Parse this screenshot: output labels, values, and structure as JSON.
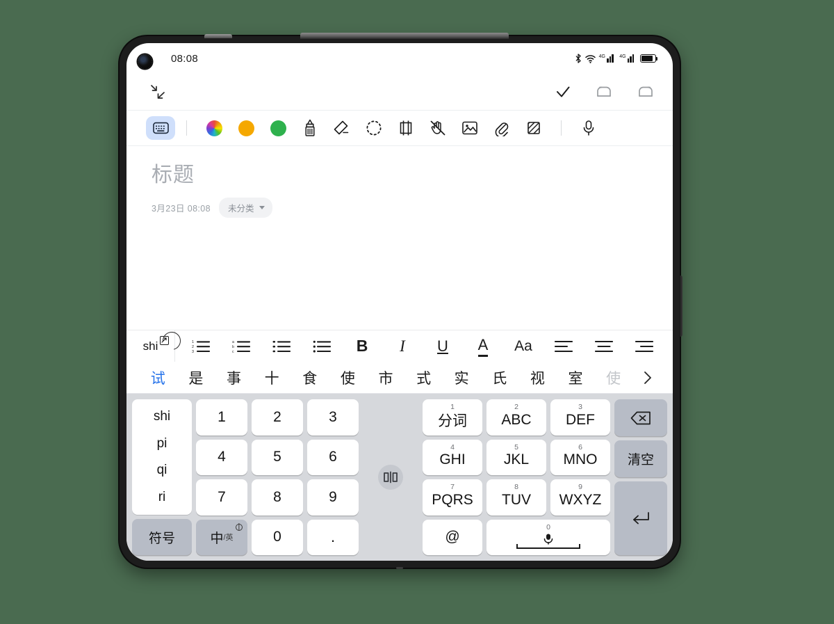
{
  "theme": {
    "background": "#4a6b50",
    "frame": "#1d1d1d",
    "accent": "#2673ea",
    "keyboard_bg": "#d6d8dc",
    "key_bg": "#ffffff",
    "key_gray": "#b7bcc6",
    "chip_bg": "#cfdffb"
  },
  "status_bar": {
    "time": "08:08",
    "icons": [
      "bluetooth-icon",
      "wifi-icon",
      "signal-icon",
      "signal-icon",
      "battery-icon"
    ],
    "signal_label": "4G"
  },
  "app_bar": {
    "collapse_icon": "collapse-arrows-icon",
    "actions": [
      {
        "name": "confirm-check-icon",
        "label": "✓"
      },
      {
        "name": "undo-icon",
        "label": "undo"
      },
      {
        "name": "redo-icon",
        "label": "redo"
      }
    ]
  },
  "toolbar": {
    "keyboard_toggle": "keyboard-icon",
    "items": [
      {
        "name": "color-wheel-icon",
        "type": "wheel",
        "color": ""
      },
      {
        "name": "color-swatch-orange",
        "type": "swatch",
        "color": "#f5a800"
      },
      {
        "name": "color-swatch-green",
        "type": "swatch",
        "color": "#2eb14d"
      },
      {
        "name": "pen-icon",
        "type": "icon",
        "color": ""
      },
      {
        "name": "eraser-icon",
        "type": "icon",
        "color": ""
      },
      {
        "name": "lasso-select-icon",
        "type": "icon",
        "color": ""
      },
      {
        "name": "crop-frame-icon",
        "type": "icon",
        "color": ""
      },
      {
        "name": "palm-reject-icon",
        "type": "icon",
        "color": ""
      },
      {
        "name": "image-icon",
        "type": "icon",
        "color": ""
      },
      {
        "name": "attachment-icon",
        "type": "icon",
        "color": ""
      },
      {
        "name": "template-icon",
        "type": "icon",
        "color": ""
      }
    ],
    "mic": "microphone-icon"
  },
  "note": {
    "title": "标题",
    "date": "3月23日 08:08",
    "category": "未分类"
  },
  "format_bar": {
    "pinyin_tab": "shi",
    "items": [
      {
        "name": "ordered-list-number-icon",
        "glyph": "list-123"
      },
      {
        "name": "ordered-list-alpha-icon",
        "glyph": "list-abc"
      },
      {
        "name": "bulleted-list-icon",
        "glyph": "list-bullet"
      },
      {
        "name": "checklist-icon",
        "glyph": "list-dot"
      },
      {
        "name": "bold-button",
        "glyph": "B"
      },
      {
        "name": "italic-button",
        "glyph": "I"
      },
      {
        "name": "underline-button",
        "glyph": "U"
      },
      {
        "name": "text-color-button",
        "glyph": "A"
      },
      {
        "name": "font-size-button",
        "glyph": "Aa"
      },
      {
        "name": "align-left-button",
        "glyph": "align-left"
      },
      {
        "name": "align-center-button",
        "glyph": "align-center"
      },
      {
        "name": "align-right-button",
        "glyph": "align-right"
      }
    ]
  },
  "candidates": {
    "list": [
      "试",
      "是",
      "事",
      "十",
      "食",
      "使",
      "市",
      "式",
      "实",
      "氏",
      "视",
      "室",
      "使"
    ],
    "active_index": 0,
    "dim_index": 12,
    "more": "›"
  },
  "keyboard": {
    "pinyin_options": [
      "shi",
      "pi",
      "qi",
      "ri"
    ],
    "symbol_key": "符号",
    "language_key": {
      "main": "中",
      "sub": "/英"
    },
    "numbers": [
      [
        "1",
        "2",
        "3"
      ],
      [
        "4",
        "5",
        "6"
      ],
      [
        "7",
        "8",
        "9"
      ],
      [
        "0",
        "."
      ]
    ],
    "split_toggle": "split-keyboard-icon",
    "letters": [
      {
        "sup": "1",
        "main": "分词"
      },
      {
        "sup": "2",
        "main": "ABC"
      },
      {
        "sup": "3",
        "main": "DEF"
      },
      {
        "sup": "4",
        "main": "GHI"
      },
      {
        "sup": "5",
        "main": "JKL"
      },
      {
        "sup": "6",
        "main": "MNO"
      },
      {
        "sup": "7",
        "main": "PQRS"
      },
      {
        "sup": "8",
        "main": "TUV"
      },
      {
        "sup": "9",
        "main": "WXYZ"
      }
    ],
    "at_key": "@",
    "space_key": {
      "sup": "0",
      "icon": "microphone-icon"
    },
    "backspace": "backspace-icon",
    "clear_key": "清空",
    "enter_key": "enter-icon"
  }
}
